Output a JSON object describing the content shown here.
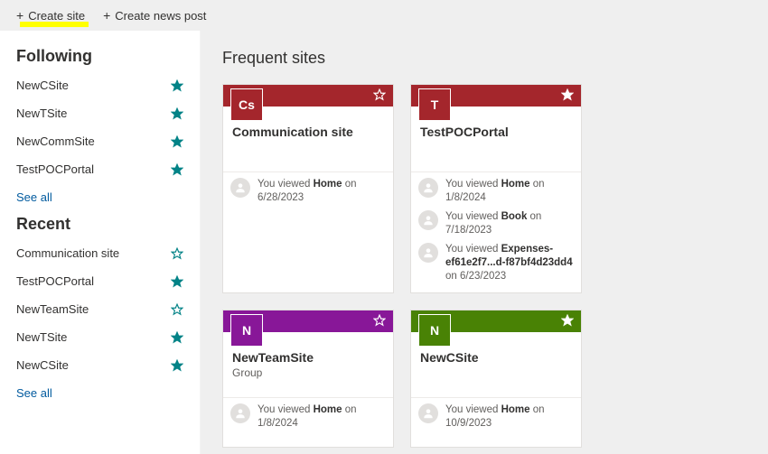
{
  "topbar": {
    "create_site": "Create site",
    "create_news": "Create news post"
  },
  "sidebar": {
    "following_heading": "Following",
    "following": [
      {
        "label": "NewCSite",
        "starred": true
      },
      {
        "label": "NewTSite",
        "starred": true
      },
      {
        "label": "NewCommSite",
        "starred": true
      },
      {
        "label": "TestPOCPortal",
        "starred": true
      }
    ],
    "recent_heading": "Recent",
    "recent": [
      {
        "label": "Communication site",
        "starred": false
      },
      {
        "label": "TestPOCPortal",
        "starred": true
      },
      {
        "label": "NewTeamSite",
        "starred": false
      },
      {
        "label": "NewTSite",
        "starred": true
      },
      {
        "label": "NewCSite",
        "starred": true
      }
    ],
    "see_all": "See all"
  },
  "content": {
    "heading": "Frequent sites",
    "cards": [
      {
        "letters": "Cs",
        "color": "c-red",
        "title": "Communication site",
        "subtitle": "",
        "header_star": "outline",
        "activities": [
          {
            "pre": "You viewed ",
            "bold": "Home",
            "post": " on 6/28/2023"
          }
        ]
      },
      {
        "letters": "T",
        "color": "c-red",
        "title": "TestPOCPortal",
        "subtitle": "",
        "header_star": "filled",
        "activities": [
          {
            "pre": "You viewed ",
            "bold": "Home",
            "post": " on 1/8/2024"
          },
          {
            "pre": "You viewed ",
            "bold": "Book",
            "post": " on 7/18/2023"
          },
          {
            "pre": "You viewed ",
            "bold": "Expenses-ef61e2f7...d-f87bf4d23dd4",
            "post": " on 6/23/2023"
          }
        ]
      },
      {
        "letters": "N",
        "color": "c-purple",
        "title": "NewTeamSite",
        "subtitle": "Group",
        "header_star": "outline",
        "activities": [
          {
            "pre": "You viewed ",
            "bold": "Home",
            "post": " on 1/8/2024"
          }
        ]
      },
      {
        "letters": "N",
        "color": "c-green",
        "title": "NewCSite",
        "subtitle": "",
        "header_star": "filled",
        "activities": [
          {
            "pre": "You viewed ",
            "bold": "Home",
            "post": " on 10/9/2023"
          }
        ]
      }
    ]
  }
}
